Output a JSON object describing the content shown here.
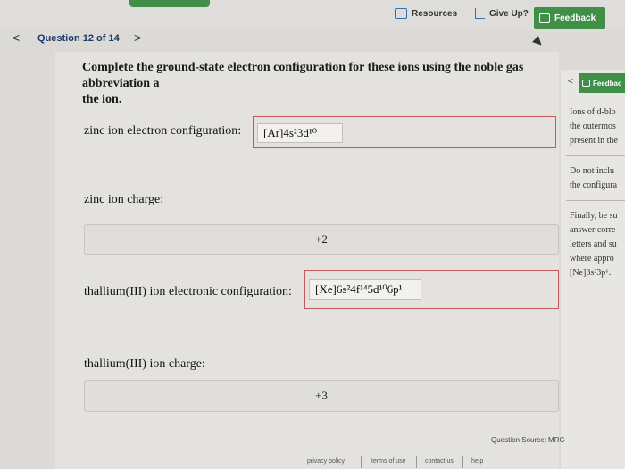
{
  "topbar": {
    "resources_label": "Resources",
    "giveup_label": "Give Up?",
    "feedback_label": "Feedback",
    "colors": {
      "accent_green": "#3f8f49",
      "icon_blue": "#2e6fb5"
    }
  },
  "nav": {
    "prev": "<",
    "question_label": "Question 12 of 14",
    "next": ">"
  },
  "question": {
    "prompt": "Complete the ground-state electron configuration for these ions using the noble gas abbreviation a",
    "prompt_line2": "the ion.",
    "zinc_config_label": "zinc ion electron configuration:",
    "zinc_config_value": "[Ar]4s²3d¹⁰",
    "zinc_charge_label": "zinc ion charge:",
    "zinc_charge_value": "+2",
    "tl_config_label": "thallium(III) ion electronic configuration:",
    "tl_config_value": "[Xe]6s²4f¹⁴5d¹⁰6p¹",
    "tl_charge_label": "thallium(III) ion charge:",
    "tl_charge_value": "+3"
  },
  "sidebar": {
    "feedback_label": "Feedbac",
    "lines": [
      "Ions of d-blo",
      "the outermos",
      "present in the",
      "Do not inclu",
      "the configura",
      "Finally, be su",
      "answer corre",
      "letters and su",
      "where appro",
      "[Ne]3s²3p⁶."
    ]
  },
  "footer": {
    "source": "Question Source: MRG",
    "links": [
      "privacy policy",
      "terms of use",
      "contact us",
      "help"
    ]
  }
}
